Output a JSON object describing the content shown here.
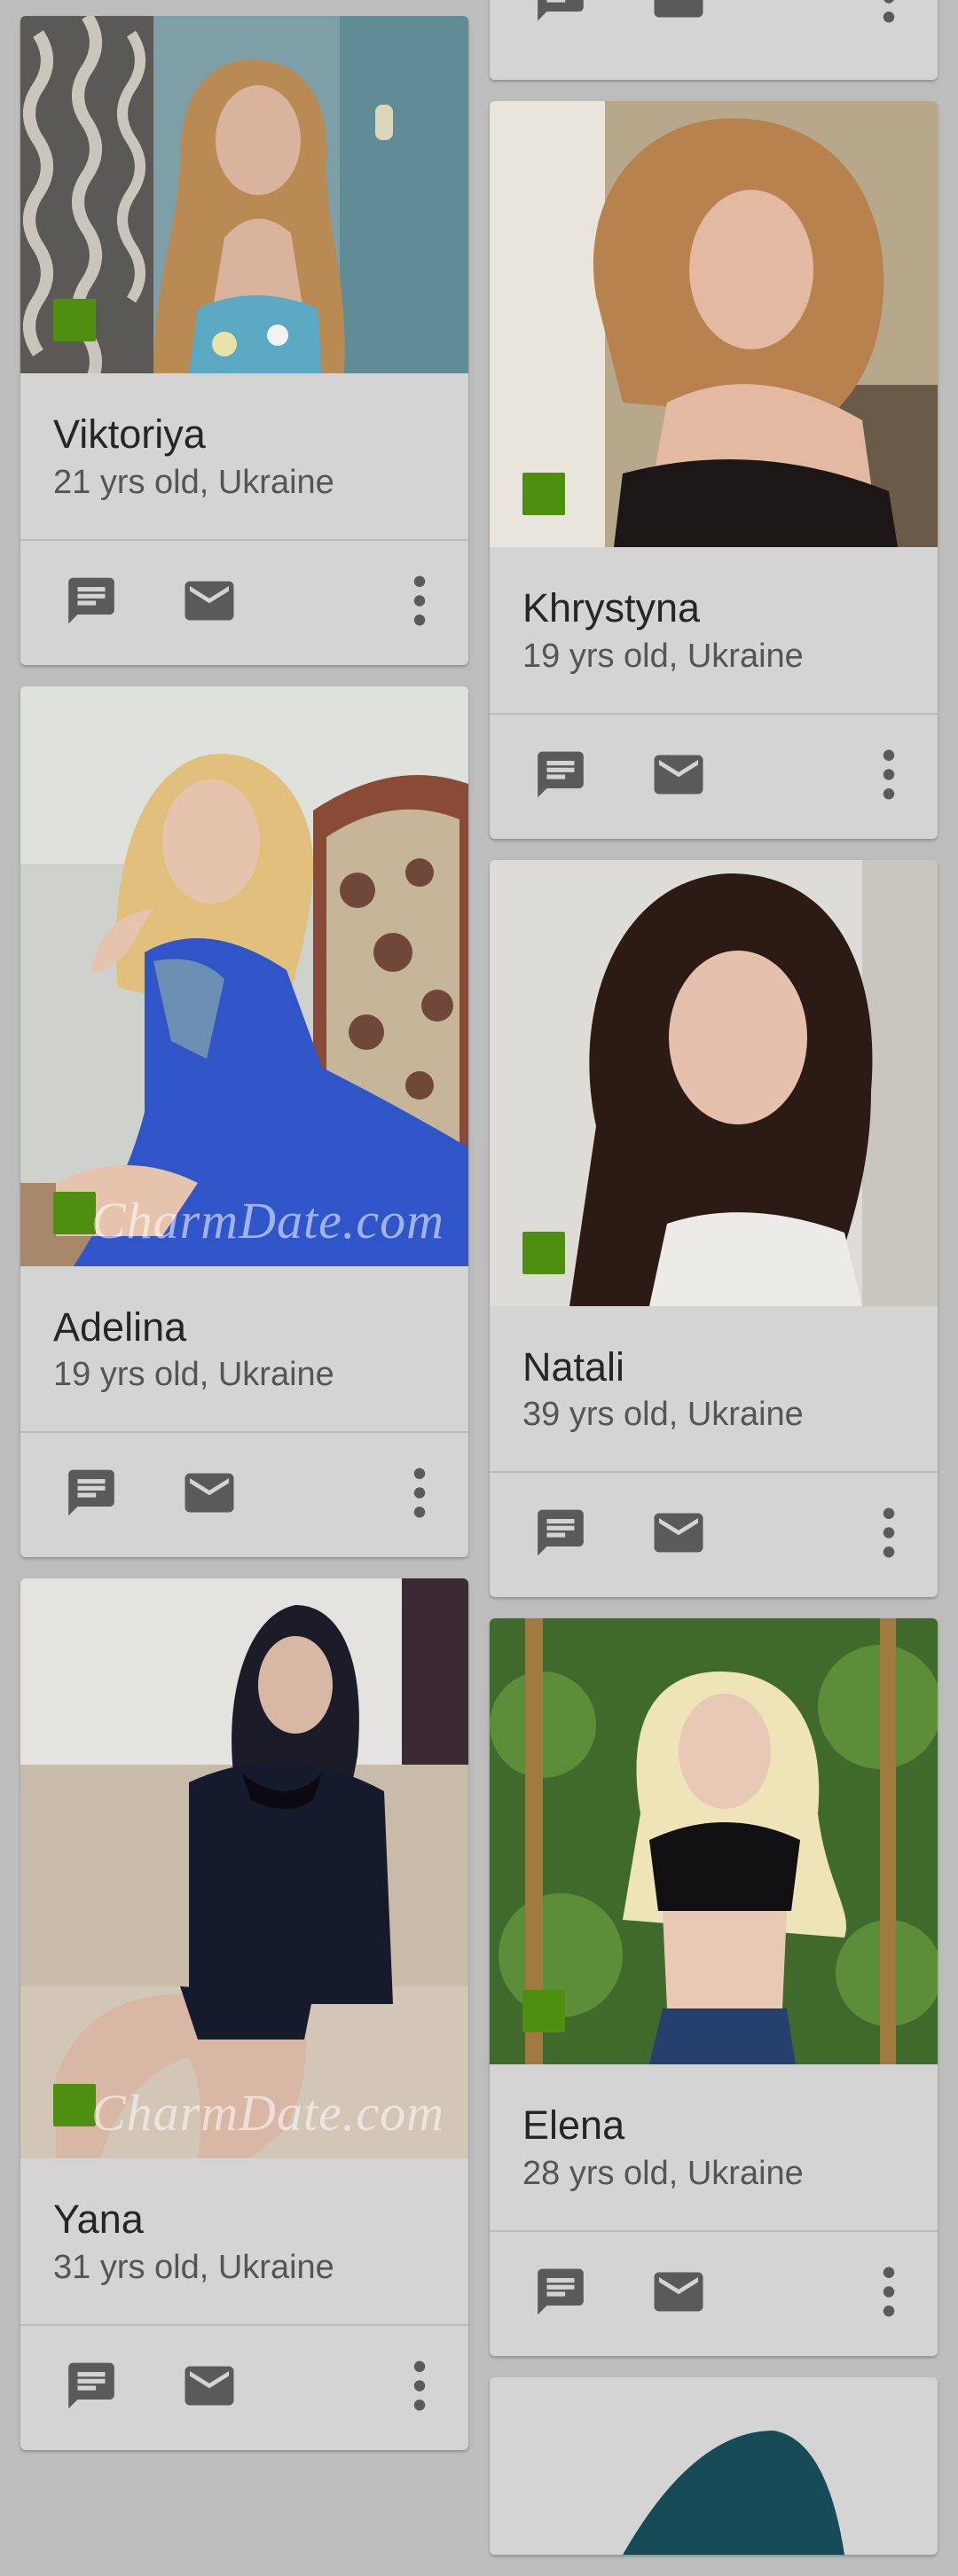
{
  "profiles_left": [
    {
      "name": "Viktoriya",
      "details": "21 yrs old, Ukraine",
      "online": true,
      "watermark": ""
    },
    {
      "name": "Adelina",
      "details": "19 yrs old, Ukraine",
      "online": true,
      "watermark": "CharmDate.com"
    },
    {
      "name": "Yana",
      "details": "31 yrs old, Ukraine",
      "online": true,
      "watermark": "CharmDate.com"
    }
  ],
  "profiles_right": [
    {
      "name": "Khrystyna",
      "details": "19 yrs old, Ukraine",
      "online": true,
      "watermark": ""
    },
    {
      "name": "Natali",
      "details": "39 yrs old, Ukraine",
      "online": true,
      "watermark": ""
    },
    {
      "name": "Elena",
      "details": "28 yrs old, Ukraine",
      "online": true,
      "watermark": ""
    }
  ],
  "icons": {
    "chat": "chat-icon",
    "mail": "mail-icon",
    "more": "more-vert-icon"
  },
  "colors": {
    "card_bg": "#d4d4d4",
    "online": "#4f8f0f",
    "icon": "#5a5a5a"
  }
}
